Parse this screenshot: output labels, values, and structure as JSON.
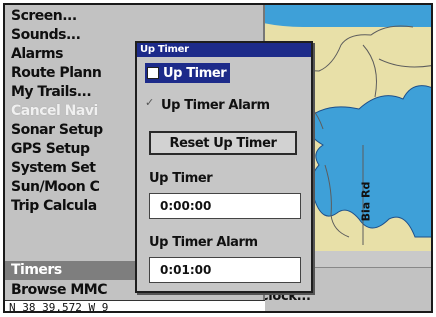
{
  "menu": {
    "items": [
      {
        "label": "Screen...",
        "state": "normal"
      },
      {
        "label": "Sounds...",
        "state": "normal"
      },
      {
        "label": "Alarms",
        "state": "normal"
      },
      {
        "label": "Route Plann",
        "state": "normal"
      },
      {
        "label": "My Trails...",
        "state": "normal"
      },
      {
        "label": "Cancel Navi",
        "state": "disabled"
      },
      {
        "label": "Sonar Setup",
        "state": "normal"
      },
      {
        "label": "GPS Setup",
        "state": "normal"
      },
      {
        "label": "System Set",
        "state": "normal"
      },
      {
        "label": "Sun/Moon C",
        "state": "normal"
      },
      {
        "label": "Trip Calcula",
        "state": "normal"
      },
      {
        "label": "Timers",
        "state": "selected"
      },
      {
        "label": "Browse MMC",
        "state": "normal"
      }
    ],
    "status_text": "N 38 39.572  W 9"
  },
  "bottom_panel": {
    "alarm_clock_label": "Alarm Clock..."
  },
  "map": {
    "road_label": "Bia Rd"
  },
  "dialog": {
    "title": "Up Timer",
    "up_timer_checkbox": {
      "label": "Up Timer",
      "checked": false
    },
    "up_timer_alarm_checkbox": {
      "label": "Up Timer Alarm",
      "checked": true
    },
    "reset_button_label": "Reset Up Timer",
    "up_timer_field": {
      "label": "Up Timer",
      "value": "0:00:00"
    },
    "alarm_field": {
      "label": "Up Timer Alarm",
      "value": "0:01:00"
    }
  },
  "colors": {
    "title_bar": "#1d2b8a",
    "selected_item": "#7e7e7e",
    "panel": "#c2c2c2",
    "map_land": "#e8e0a8",
    "map_water": "#3ea0d8"
  }
}
